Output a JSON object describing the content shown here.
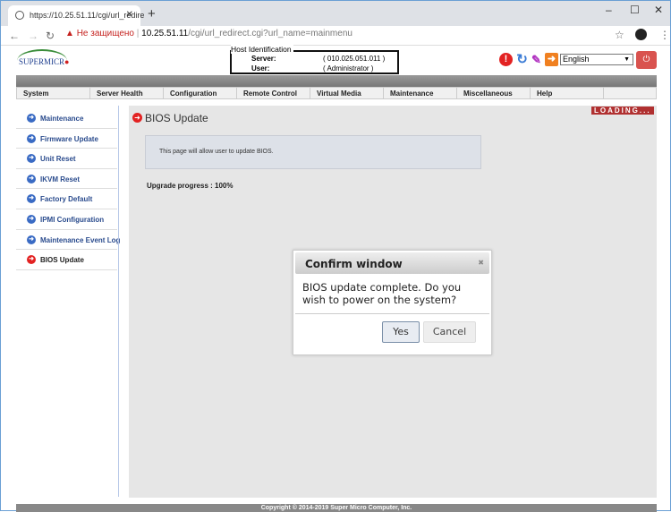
{
  "browser": {
    "tab_title": "https://10.25.51.11/cgi/url_redire",
    "url_warning": "Не защищено",
    "url_host": "10.25.51.11",
    "url_path": "/cgi/url_redirect.cgi?url_name=mainmenu"
  },
  "header": {
    "logo": "SUPERMICRO",
    "host_label": "Host Identification",
    "server_label": "Server:",
    "server_value": "( 010.025.051.011 )",
    "user_label": "User:",
    "user_value": "( Administrator )",
    "language": "English"
  },
  "menu": [
    "System",
    "Server Health",
    "Configuration",
    "Remote Control",
    "Virtual Media",
    "Maintenance",
    "Miscellaneous",
    "Help"
  ],
  "sidebar": [
    {
      "label": "Maintenance"
    },
    {
      "label": "Firmware Update"
    },
    {
      "label": "Unit Reset"
    },
    {
      "label": "IKVM Reset"
    },
    {
      "label": "Factory Default"
    },
    {
      "label": "IPMI Configuration"
    },
    {
      "label": "Maintenance Event Log"
    },
    {
      "label": "BIOS Update",
      "active": true
    }
  ],
  "main": {
    "title": "BIOS Update",
    "loading": "LOADING...",
    "info": "This page will allow user to update BIOS.",
    "progress": "Upgrade progress : 100%"
  },
  "dialog": {
    "title": "Confirm window",
    "message": "BIOS update complete. Do you wish to power on the system?",
    "yes": "Yes",
    "cancel": "Cancel"
  },
  "footer": "Copyright © 2014-2019 Super Micro Computer, Inc.",
  "colors": {
    "accent_red": "#e32222",
    "link_blue": "#2a4b8d",
    "power_button": "#d9534f"
  }
}
